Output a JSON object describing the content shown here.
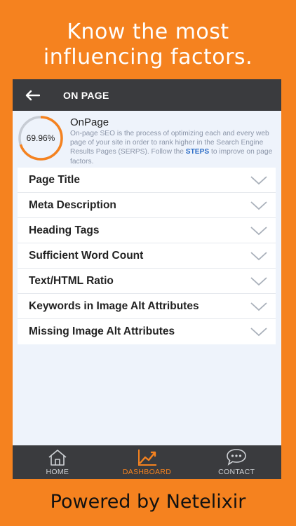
{
  "promo": {
    "line1": "Know the most",
    "line2": "influencing factors."
  },
  "app_bar": {
    "title": "ON PAGE",
    "back_icon": "arrow-left-icon"
  },
  "summary": {
    "score": "69.96%",
    "score_fraction": 0.6996,
    "title": "OnPage",
    "description": "On-page SEO is the process of optimizing each and every web page of your site in order to rank higher in the Search Engine Results Pages (SERPS). Follow the",
    "steps_link": "STEPS",
    "description_end": "to improve on page factors."
  },
  "factors": [
    {
      "label": "Page Title"
    },
    {
      "label": "Meta Description"
    },
    {
      "label": "Heading Tags"
    },
    {
      "label": "Sufficient Word Count"
    },
    {
      "label": "Text/HTML Ratio"
    },
    {
      "label": "Keywords in Image Alt Attributes"
    },
    {
      "label": "Missing Image Alt Attributes"
    }
  ],
  "bottom_nav": {
    "items": [
      {
        "label": "HOME",
        "icon": "home-icon",
        "active": false
      },
      {
        "label": "DASHBOARD",
        "icon": "chart-trend-icon",
        "active": true
      },
      {
        "label": "CONTACT",
        "icon": "chat-bubble-icon",
        "active": false
      }
    ]
  },
  "footer": {
    "text": "Powered by Netelixir"
  },
  "colors": {
    "background": "#f5821f",
    "bar": "#3a3b3e",
    "gauge_fill": "#f5821f",
    "gauge_track": "#c7ccd4",
    "accent_link": "#2b6cc6"
  }
}
